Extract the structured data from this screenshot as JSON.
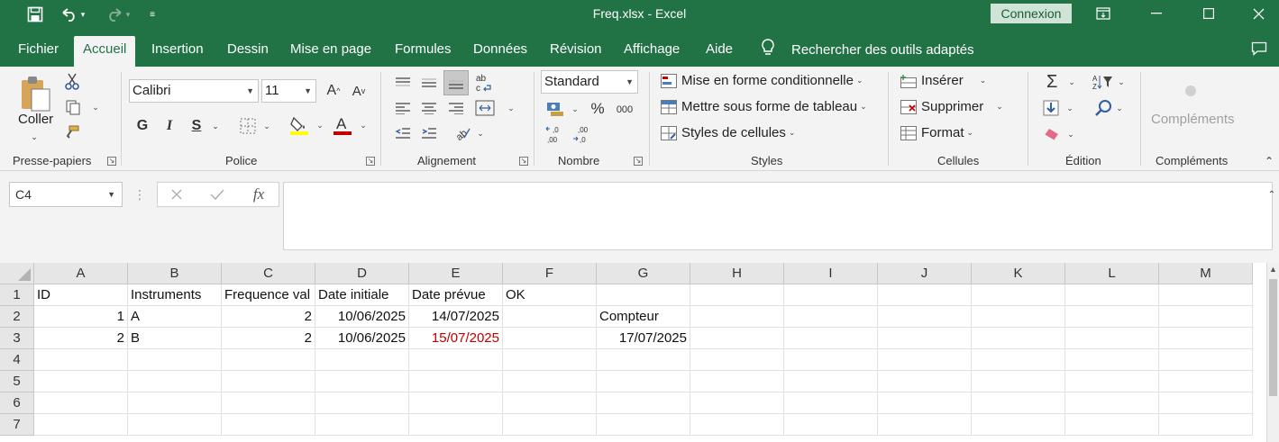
{
  "app": {
    "window_title": "Freq.xlsx  -  Excel",
    "connexion_label": "Connexion"
  },
  "quick_access": [
    "save-icon",
    "undo-icon",
    "redo-icon",
    "customize-icon"
  ],
  "tabs": [
    {
      "label": "Fichier"
    },
    {
      "label": "Accueil",
      "active": true
    },
    {
      "label": "Insertion"
    },
    {
      "label": "Dessin"
    },
    {
      "label": "Mise en page"
    },
    {
      "label": "Formules"
    },
    {
      "label": "Données"
    },
    {
      "label": "Révision"
    },
    {
      "label": "Affichage"
    },
    {
      "label": "Aide"
    }
  ],
  "tell_me": "Rechercher des outils adaptés",
  "ribbon": {
    "clipboard": {
      "paste_label": "Coller",
      "group_label": "Presse-papiers"
    },
    "font": {
      "font_name": "Calibri",
      "font_size": "11",
      "bold": "G",
      "italic": "I",
      "underline": "S",
      "group_label": "Police"
    },
    "alignment": {
      "group_label": "Alignement"
    },
    "number": {
      "format": "Standard",
      "percent": "%",
      "thousands": "000",
      "group_label": "Nombre"
    },
    "styles": {
      "conditional": "Mise en forme conditionnelle",
      "as_table": "Mettre sous forme de tableau",
      "cell_styles": "Styles de cellules",
      "group_label": "Styles"
    },
    "cells": {
      "insert": "Insérer",
      "delete": "Supprimer",
      "format": "Format",
      "group_label": "Cellules"
    },
    "editing": {
      "group_label": "Édition"
    },
    "addins": {
      "label": "Compléments",
      "group_label": "Compléments"
    }
  },
  "formula_bar": {
    "name_box": "C4",
    "formula": ""
  },
  "colors": {
    "excel_green": "#217346",
    "red_text": "#c00000"
  },
  "sheet": {
    "columns": [
      "A",
      "B",
      "C",
      "D",
      "E",
      "F",
      "G",
      "H",
      "I",
      "J",
      "K",
      "L",
      "M"
    ],
    "rows": [
      "1",
      "2",
      "3",
      "4",
      "5",
      "6",
      "7"
    ],
    "cells": {
      "A1": "ID",
      "B1": "Instruments",
      "C1": "Frequence val",
      "D1": "Date initiale",
      "E1": "Date prévue",
      "F1": "OK",
      "A2": "1",
      "B2": "A",
      "C2": "2",
      "D2": "10/06/2025",
      "E2": "14/07/2025",
      "G2": "Compteur",
      "A3": "2",
      "B3": "B",
      "C3": "2",
      "D3": "10/06/2025",
      "E3": "15/07/2025",
      "G3": "17/07/2025"
    }
  }
}
